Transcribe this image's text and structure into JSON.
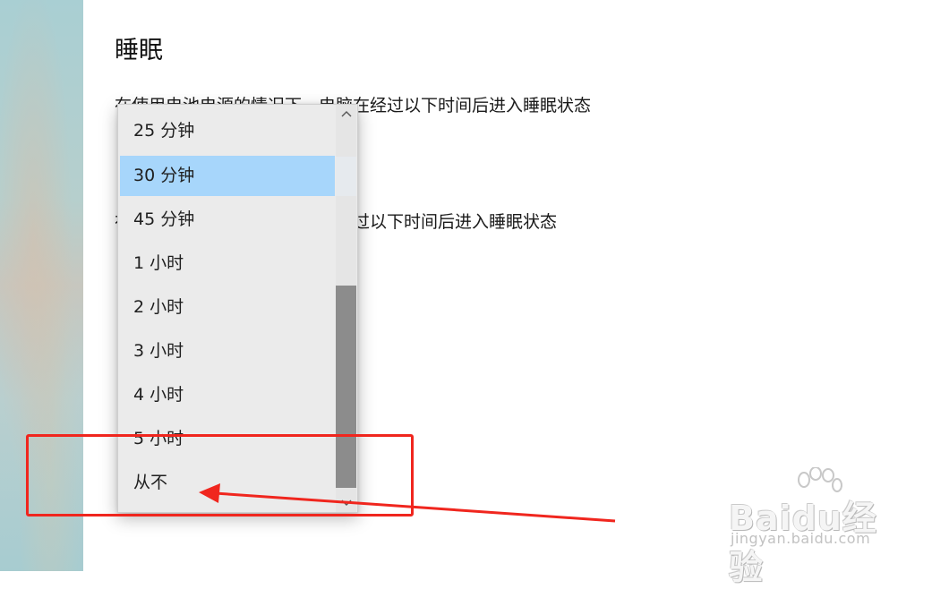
{
  "settings": {
    "section_title": "睡眠",
    "battery_description": "在使用电池电源的情况下，电脑在经过以下时间后进入睡眠状态",
    "plugged_description": "在接通电源的情况下，电脑在经过以下时间后进入睡眠状态"
  },
  "dropdown": {
    "options": [
      "25 分钟",
      "30 分钟",
      "45 分钟",
      "1 小时",
      "2 小时",
      "3 小时",
      "4 小时",
      "5 小时",
      "从不"
    ],
    "selected": "30 分钟",
    "scroll_up_glyph": "^",
    "scroll_down_glyph": "v"
  },
  "watermark": {
    "brand": "Baidu经验",
    "url": "jingyan.baidu.com"
  },
  "colors": {
    "selection": "#a7d6fb",
    "annotation": "#f0261e",
    "scroll_thumb": "#8c8c8c"
  }
}
